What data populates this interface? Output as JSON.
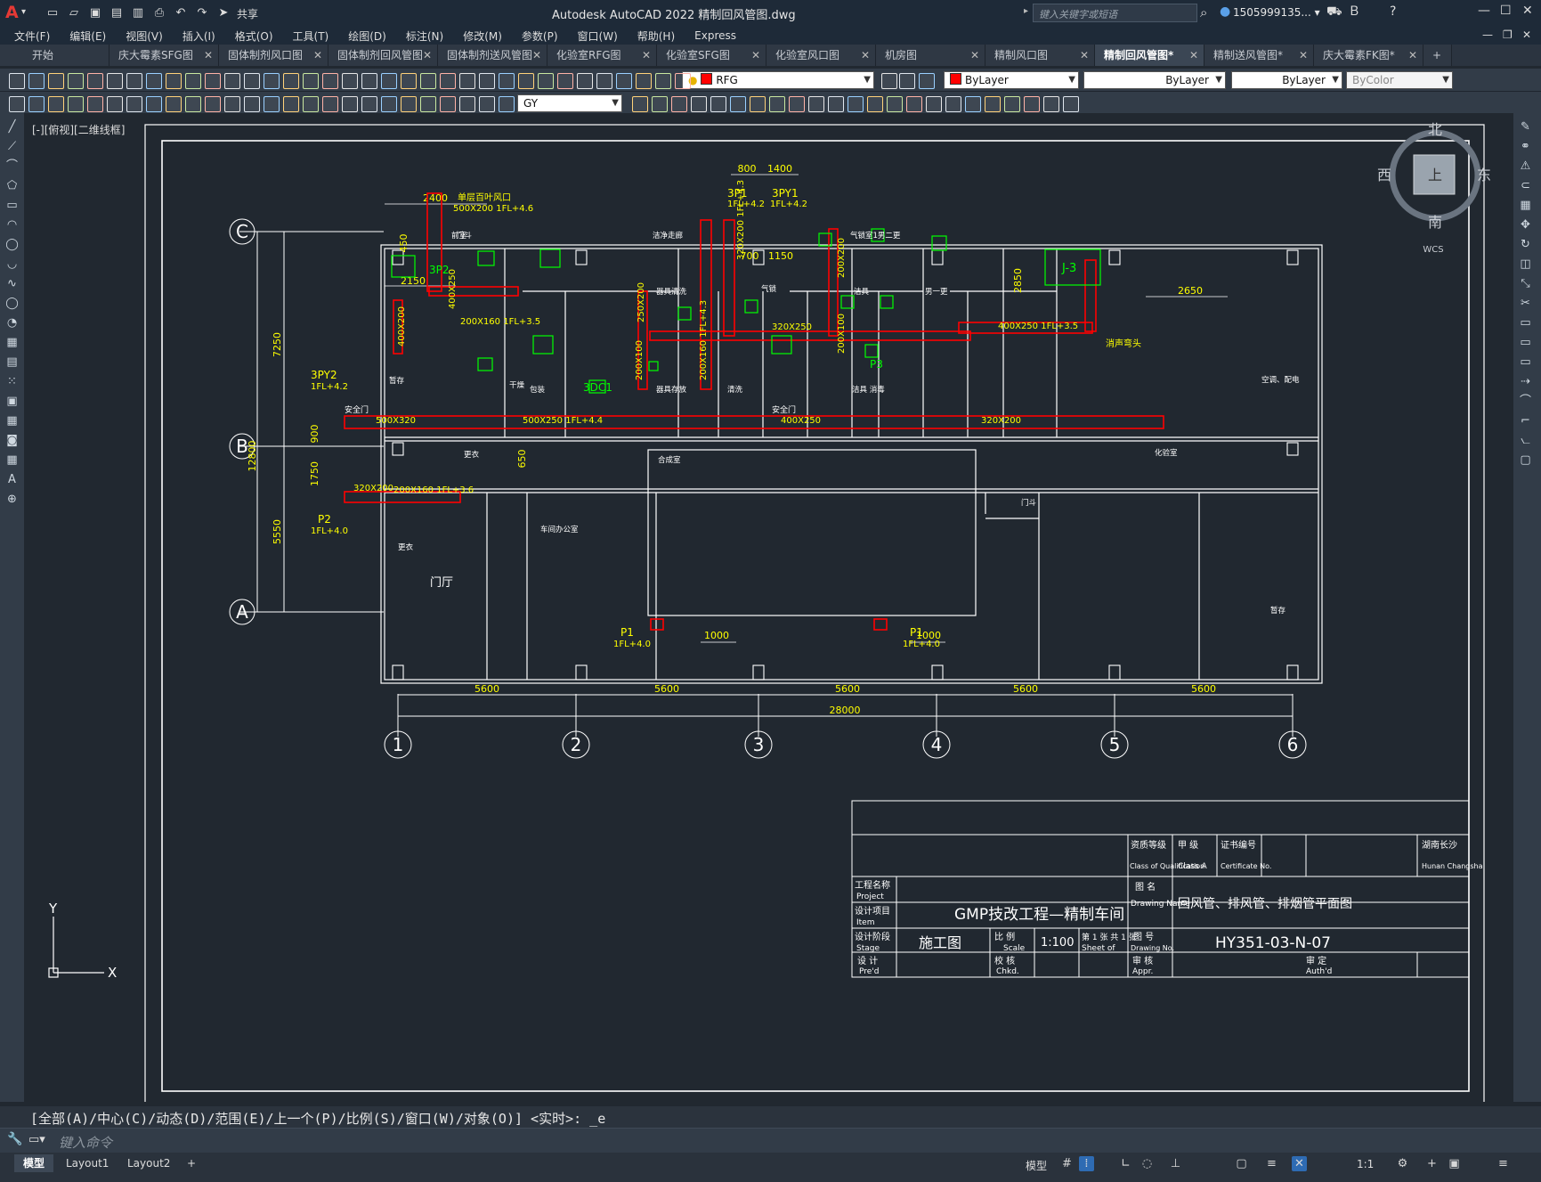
{
  "app": {
    "title": "Autodesk AutoCAD 2022    精制回风管图.dwg",
    "logo": "A",
    "search_placeholder": "键入关键字或短语",
    "user": "1505999135... ▾",
    "share": "共享"
  },
  "menu": [
    "文件(F)",
    "编辑(E)",
    "视图(V)",
    "插入(I)",
    "格式(O)",
    "工具(T)",
    "绘图(D)",
    "标注(N)",
    "修改(M)",
    "参数(P)",
    "窗口(W)",
    "帮助(H)",
    "Express"
  ],
  "tabs": [
    {
      "label": "开始",
      "active": false
    },
    {
      "label": "庆大霉素SFG图",
      "active": false
    },
    {
      "label": "固体制剂风口图",
      "active": false
    },
    {
      "label": "固体制剂回风管图",
      "active": false
    },
    {
      "label": "固体制剂送风管图",
      "active": false
    },
    {
      "label": "化验室RFG图",
      "active": false
    },
    {
      "label": "化验室SFG图",
      "active": false
    },
    {
      "label": "化验室风口图",
      "active": false
    },
    {
      "label": "机房图",
      "active": false
    },
    {
      "label": "精制风口图",
      "active": false
    },
    {
      "label": "精制回风管图*",
      "active": true
    },
    {
      "label": "精制送风管图*",
      "active": false
    },
    {
      "label": "庆大霉素FK图*",
      "active": false
    }
  ],
  "toolbar": {
    "layer_value": "RFG",
    "color_value": "ByLayer",
    "linetype_value": "ByLayer",
    "lineweight_value": "ByLayer",
    "plotstyle_value": "ByColor",
    "textstyle_value": "GY"
  },
  "viewport_label": "[-][俯视][二维线框]",
  "viewcube": {
    "north": "北",
    "south": "南",
    "east": "东",
    "west": "西",
    "top": "上",
    "wcs": "WCS"
  },
  "drawing": {
    "axes_letters": [
      "C",
      "B",
      "A"
    ],
    "axes_numbers": [
      "1",
      "2",
      "3",
      "4",
      "5",
      "6"
    ],
    "bay_dims": [
      "5600",
      "5600",
      "5600",
      "5600",
      "5600"
    ],
    "total_dim": "28000",
    "left_dims": {
      "top": "7250",
      "total": "12800",
      "mid": "5550",
      "small1": "900",
      "small2": "1750"
    },
    "top_dims": {
      "d1": "2400",
      "d2": "800",
      "d3": "1400",
      "d4": "2150",
      "d5": "700",
      "d6": "1150",
      "d7": "2850",
      "d8": "2650",
      "d9": "450",
      "d10": "650",
      "d11": "1000",
      "d12": "1000"
    },
    "labels": {
      "sp": "单层百叶风口",
      "sp_sub": "500X200 1FL+4.6",
      "p3p1": "3P1",
      "p3p1_sub": "1FL+4.2",
      "p3py1": "3PY1",
      "p3py1_sub": "1FL+4.2",
      "p3py2": "3PY2",
      "p3py2_sub": "1FL+4.2",
      "p2": "P2",
      "p2_sub": "1FL+4.0",
      "p1a": "P1",
      "p1a_sub": "1FL+4.0",
      "p1b": "P1",
      "p1b_sub": "1FL+4.0",
      "xsq": "消声弯头",
      "j3": "J-3",
      "p3": "P3",
      "p3p2": "3P2",
      "dc1": "3DC1"
    },
    "duct_labels": {
      "d1": "200X160 1FL+3.5",
      "d2": "400X250",
      "d3": "400X250 1FL+3.5",
      "d4": "320X250",
      "d5": "500X320",
      "d6": "500X250 1FL+4.4",
      "d7": "400X250",
      "d8": "320X200",
      "d9": "320X200",
      "d10": "200X160 1FL+3.6",
      "d11": "400X200",
      "d12": "200X160 1FL+4.3",
      "d13": "320X200 1FL+4.3",
      "d14": "250X200",
      "d15": "200X100",
      "d16": "200X200",
      "d17": "200X100",
      "d18": "400X250"
    },
    "rooms": {
      "r1": "门斗",
      "r2": "洁净走廊",
      "r3": "气锁室1男二更",
      "r4": "前室",
      "r5": "暂存",
      "r6": "干燥",
      "r7": "包装",
      "r8": "器具清洗",
      "r9": "器具存放",
      "r10": "洁具",
      "r11": "男一更",
      "r12": "清洗",
      "r13": "气锁",
      "r14": "洁具 消毒",
      "r15": "空调、配电",
      "r16": "安全门",
      "r17": "安全门",
      "r18": "更衣",
      "r19": "车间办公室",
      "r20": "合成室",
      "r21": "门斗",
      "r22": "化验室",
      "r23": "更衣",
      "r24": "门厅",
      "r25": "暂存"
    }
  },
  "title_block": {
    "qual_label": "资质等级",
    "qual_en": "Class of Qualification",
    "grade_label": "甲  级",
    "grade_en": "Class A",
    "cert_label": "证书编号",
    "cert_en": "Certificate No.",
    "loc_label": "湖南长沙",
    "loc_en": "Hunan Changsha",
    "project_label": "工程名称",
    "project_en": "Project",
    "item_label": "设计项目",
    "item_en": "Item",
    "project_value": "GMP技改工程—精制车间",
    "drawing_label": "图  名",
    "drawing_en": "Drawing Name",
    "drawing_value": "回风管、排风管、排烟管平面图",
    "stage_label": "设计阶段",
    "stage_en": "Stage",
    "stage_value": "施工图",
    "scale_label": "比  例",
    "scale_en": "Scale",
    "scale_value": "1:100",
    "sheet_label": "第 1 张 共 1 张",
    "sheet_en": "Sheet    of",
    "drawno_label": "图  号",
    "drawno_en": "Drawing No.",
    "drawno_value": "HY351-03-N-07",
    "pre_label": "设  计",
    "pre_en": "Pre'd",
    "chk_label": "校  核",
    "chk_en": "Chkd.",
    "appr_label": "审  核",
    "appr_en": "Appr.",
    "auth_label": "审  定",
    "auth_en": "Auth'd"
  },
  "ucs": {
    "x": "X",
    "y": "Y"
  },
  "command": {
    "history": "[全部(A)/中心(C)/动态(D)/范围(E)/上一个(P)/比例(S)/窗口(W)/对象(O)] <实时>: _e",
    "placeholder": "键入命令"
  },
  "status": {
    "layouts": [
      "模型",
      "Layout1",
      "Layout2"
    ],
    "model_label": "模型",
    "scale": "1:1"
  },
  "colors": {
    "duct": "#ff0000",
    "annot": "#ffff00",
    "diffuser": "#00ff00",
    "walls": "#ffffff"
  }
}
